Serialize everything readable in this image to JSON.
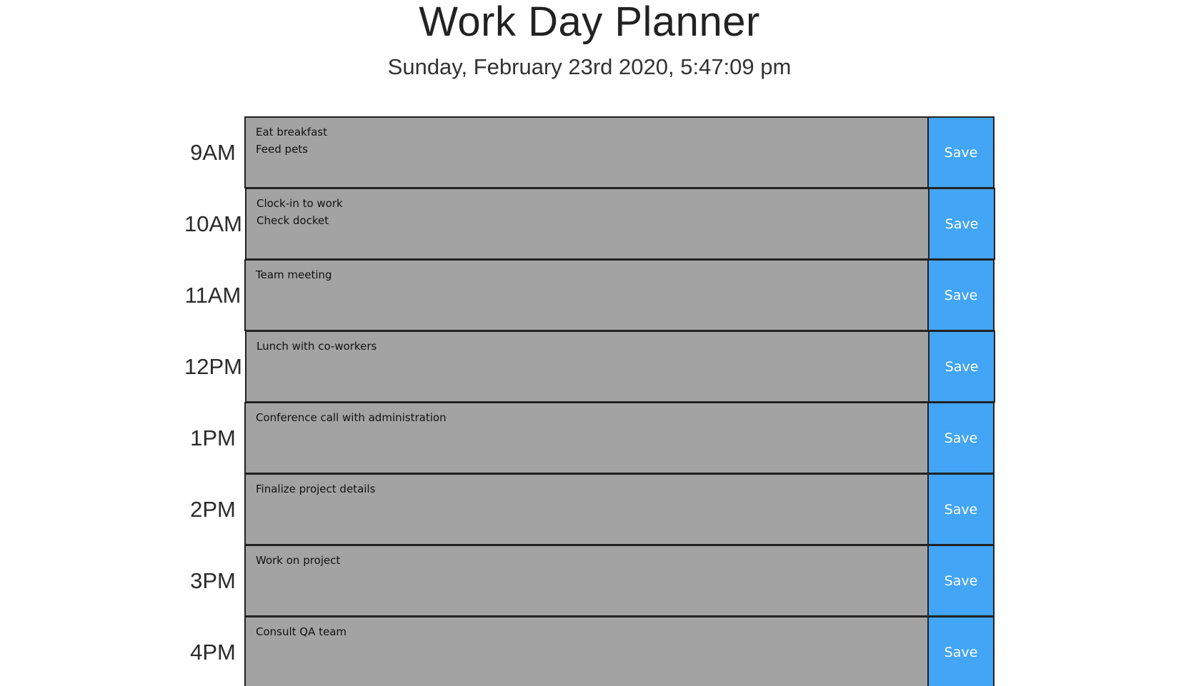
{
  "header": {
    "title": "Work Day Planner",
    "current_datetime": "Sunday, February 23rd 2020, 5:47:09 pm"
  },
  "colors": {
    "past_block": "#a3a3a3",
    "save_button": "#42a5f5"
  },
  "planner": {
    "rows": [
      {
        "hour": "9AM",
        "task": "Eat breakfast\nFeed pets",
        "save_label": "Save"
      },
      {
        "hour": "10AM",
        "task": "Clock-in to work\nCheck docket",
        "save_label": "Save"
      },
      {
        "hour": "11AM",
        "task": "Team meeting",
        "save_label": "Save"
      },
      {
        "hour": "12PM",
        "task": "Lunch with co-workers",
        "save_label": "Save"
      },
      {
        "hour": "1PM",
        "task": "Conference call with administration",
        "save_label": "Save"
      },
      {
        "hour": "2PM",
        "task": "Finalize project details",
        "save_label": "Save"
      },
      {
        "hour": "3PM",
        "task": "Work on project",
        "save_label": "Save"
      },
      {
        "hour": "4PM",
        "task": "Consult QA team",
        "save_label": "Save"
      }
    ]
  }
}
